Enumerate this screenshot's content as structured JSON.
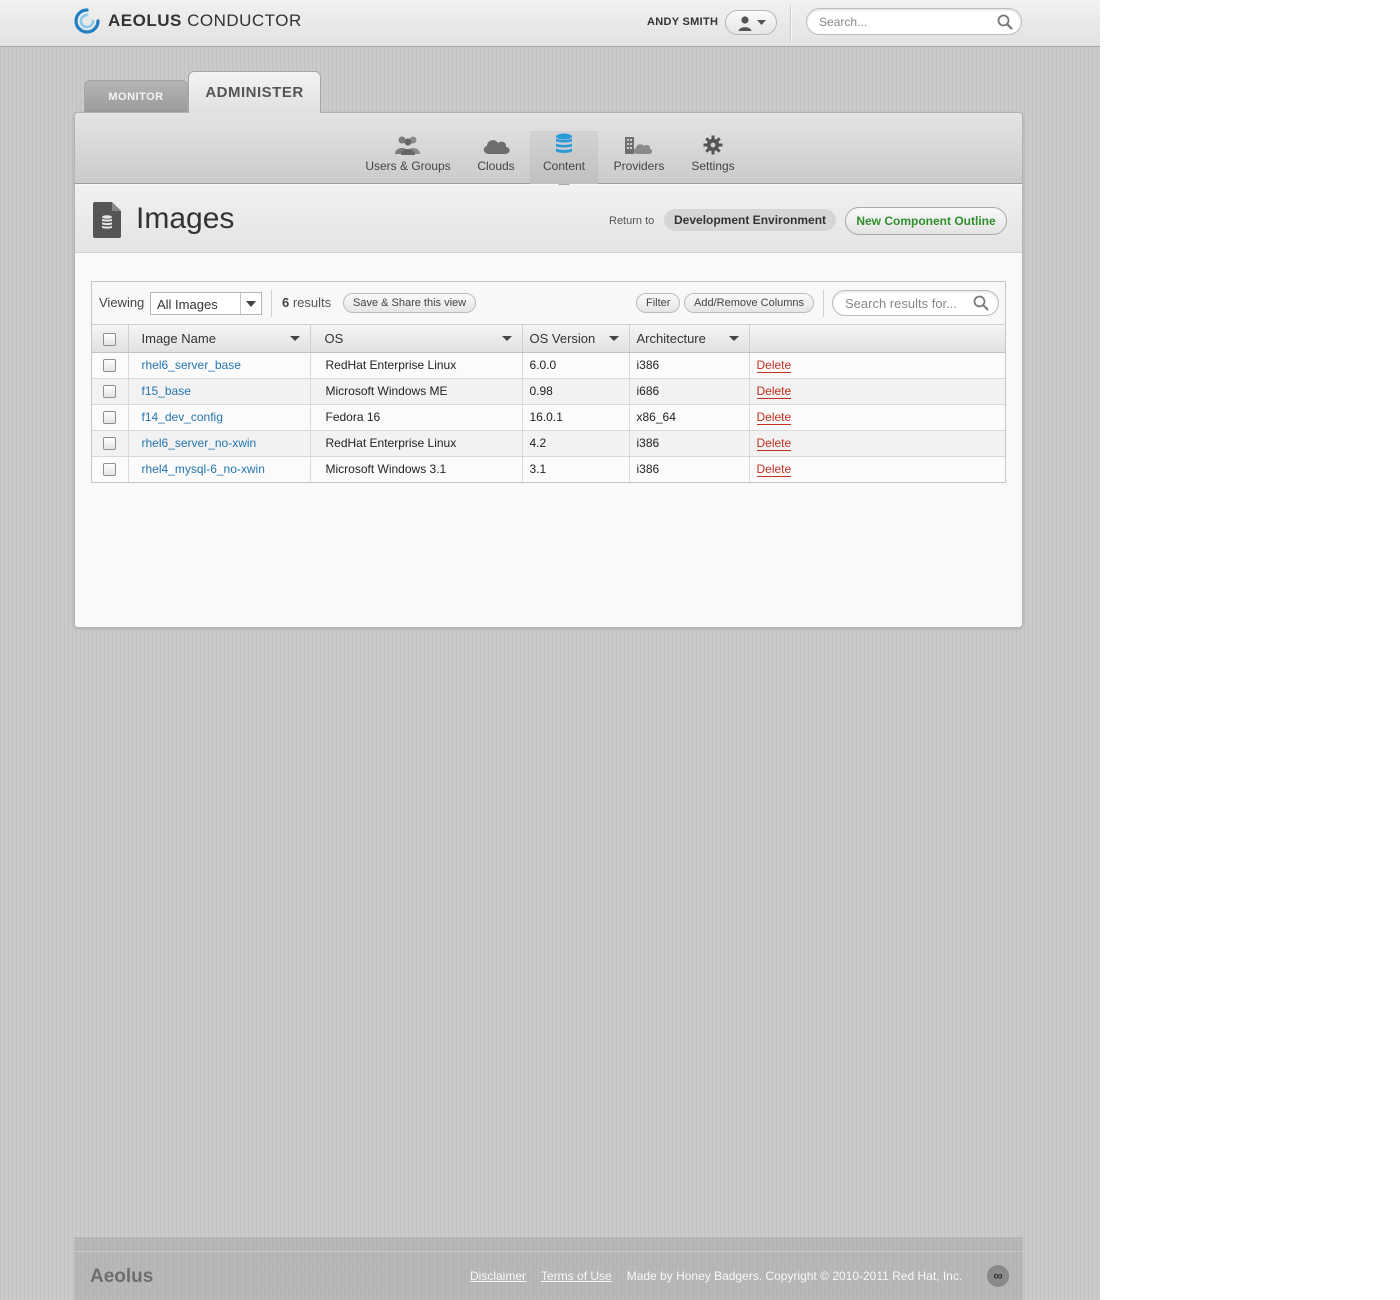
{
  "app": {
    "brand_bold": "AEOLUS",
    "brand_light": " CONDUCTOR"
  },
  "user": {
    "name": "ANDY SMITH"
  },
  "global_search": {
    "placeholder": "Search..."
  },
  "tabs": [
    {
      "label": "MONITOR",
      "active": false
    },
    {
      "label": "ADMINISTER",
      "active": true
    }
  ],
  "subnav": [
    {
      "label": "Users & Groups",
      "icon": "users-icon"
    },
    {
      "label": "Clouds",
      "icon": "cloud-icon"
    },
    {
      "label": "Content",
      "icon": "database-icon",
      "active": true
    },
    {
      "label": "Providers",
      "icon": "providers-icon"
    },
    {
      "label": "Settings",
      "icon": "gear-icon"
    }
  ],
  "header": {
    "title": "Images",
    "return_label": "Return to",
    "return_target": "Development Environment",
    "new_outline_label": "New Component Outline"
  },
  "toolbar": {
    "viewing_label": "Viewing",
    "viewing_value": "All Images",
    "result_count": "6",
    "result_suffix": " results",
    "save_share_label": "Save & Share this view",
    "filter_label": "Filter",
    "columns_label": "Add/Remove Columns",
    "search_placeholder": "Search results for..."
  },
  "table": {
    "columns": [
      "Image Name",
      "OS",
      "OS Version",
      "Architecture"
    ],
    "rows": [
      {
        "name": "rhel6_server_base",
        "os": "RedHat Enterprise Linux",
        "version": "6.0.0",
        "arch": "i386",
        "action": "Delete"
      },
      {
        "name": "f15_base",
        "os": "Microsoft Windows ME",
        "version": "0.98",
        "arch": "i686",
        "action": "Delete"
      },
      {
        "name": "f14_dev_config",
        "os": "Fedora 16",
        "version": "16.0.1",
        "arch": "x86_64",
        "action": "Delete"
      },
      {
        "name": "rhel6_server_no-xwin",
        "os": "RedHat Enterprise Linux",
        "version": "4.2",
        "arch": "i386",
        "action": "Delete"
      },
      {
        "name": "rhel4_mysql-6_no-xwin",
        "os": "Microsoft Windows 3.1",
        "version": "3.1",
        "arch": "i386",
        "action": "Delete"
      }
    ]
  },
  "footer": {
    "brand": "Aeolus",
    "disclaimer": "Disclaimer",
    "terms": "Terms of Use",
    "copyright": "Made by Honey Badgers. Copyright © 2010-2011 Red Hat, Inc.",
    "badge": "∞"
  },
  "colors": {
    "link": "#2475b0",
    "delete": "#c0301f",
    "accent_green": "#2f8f2a",
    "content_icon_blue": "#2a9bd8"
  }
}
